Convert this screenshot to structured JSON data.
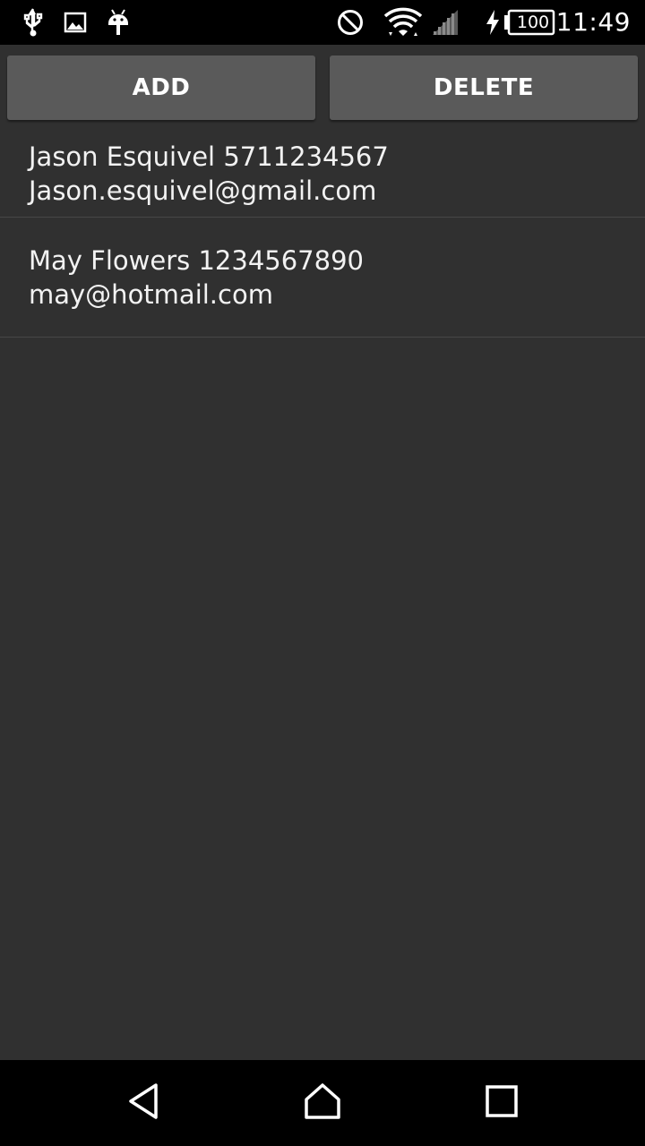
{
  "status_bar": {
    "time": "11:49",
    "battery_level": "100",
    "left_icons": [
      "usb-icon",
      "image-icon",
      "android-icon"
    ],
    "right_icons": [
      "do-not-disturb-icon",
      "wifi-icon",
      "cell-signal-icon",
      "charging-icon",
      "battery-icon"
    ]
  },
  "toolbar": {
    "add_label": "ADD",
    "delete_label": "DELETE"
  },
  "contacts": [
    {
      "line1": "Jason Esquivel 5711234567",
      "line2": "Jason.esquivel@gmail.com"
    },
    {
      "line1": "May Flowers 1234567890 may@hotmail.com"
    }
  ],
  "nav_bar": {
    "icons": [
      "back-icon",
      "home-icon",
      "recents-icon"
    ]
  },
  "colors": {
    "background": "#303030",
    "button": "#5a5a5a",
    "bars": "#000000",
    "text": "#f2f2f2"
  }
}
